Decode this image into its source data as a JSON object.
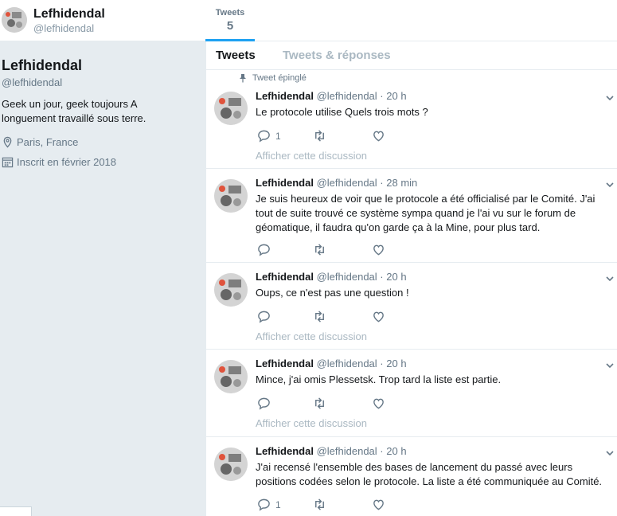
{
  "header": {
    "name": "Lefhidendal",
    "handle": "@lefhidendal",
    "stat_label": "Tweets",
    "stat_value": "5"
  },
  "profile": {
    "name": "Lefhidendal",
    "handle": "@lefhidendal",
    "bio": "Geek un jour, geek toujours A longuement travaillé sous terre.",
    "location": "Paris, France",
    "joined": "Inscrit en février 2018"
  },
  "tabs": {
    "tweets": "Tweets",
    "replies": "Tweets & réponses"
  },
  "pinned_label": "Tweet épinglé",
  "thread_label": "Afficher cette discussion",
  "tweets": [
    {
      "name": "Lefhidendal",
      "handle": "@lefhidendal",
      "dot": "·",
      "time": "20 h",
      "text": "Le protocole utilise Quels trois mots ?",
      "reply_count": "1"
    },
    {
      "name": "Lefhidendal",
      "handle": "@lefhidendal",
      "dot": "·",
      "time": "28 min",
      "text": "Je suis heureux de voir que le protocole a été officialisé par le Comité. J'ai tout de suite trouvé ce système sympa quand je l'ai vu sur le forum de géomatique, il faudra qu'on garde ça à la Mine, pour plus tard.",
      "reply_count": ""
    },
    {
      "name": "Lefhidendal",
      "handle": "@lefhidendal",
      "dot": "·",
      "time": "20 h",
      "text": "Oups, ce n'est pas une question !",
      "reply_count": ""
    },
    {
      "name": "Lefhidendal",
      "handle": "@lefhidendal",
      "dot": "·",
      "time": "20 h",
      "text": "Mince, j'ai omis Plessetsk. Trop tard la liste est partie.",
      "reply_count": ""
    },
    {
      "name": "Lefhidendal",
      "handle": "@lefhidendal",
      "dot": "·",
      "time": "20 h",
      "text": "J'ai recensé l'ensemble des bases de lancement du passé avec leurs positions codées selon le protocole. La liste a été communiquée au Comité.",
      "reply_count": "1"
    }
  ],
  "colors": {
    "accent": "#1da1f2",
    "background": "#e6ecf0",
    "muted": "#657786",
    "faint": "#aab8c2"
  }
}
